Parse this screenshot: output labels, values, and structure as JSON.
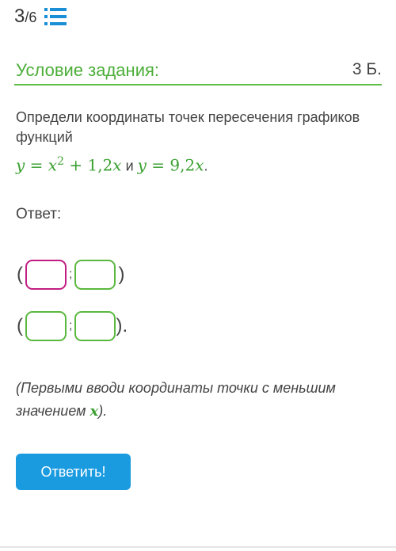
{
  "header": {
    "progress_current": "3",
    "progress_total": "/6",
    "list_icon": "list-icon"
  },
  "task": {
    "section_title": "Условие задания:",
    "points": "3 Б.",
    "text": "Определи координаты точек пересечения графиков функций",
    "formula": {
      "y1": "y",
      "eq1": " = ",
      "x1": "x",
      "pow": "2",
      "rest1": " + 1,2",
      "x2": "x",
      "conj": " и ",
      "y2": "y",
      "eq2": " = 9,2",
      "x3": "x",
      "end": "."
    }
  },
  "answer": {
    "label": "Ответ:",
    "rows": [
      {
        "open": "(",
        "sep": ";",
        "close": ")",
        "x_value": "",
        "y_value": ""
      },
      {
        "open": "(",
        "sep": ";",
        "close": ").",
        "x_value": "",
        "y_value": ""
      }
    ]
  },
  "note": {
    "text": "(Первыми вводи координаты точки с меньшим значением ",
    "var": "x",
    "end": ")."
  },
  "submit_button": {
    "label": "Ответить!"
  },
  "colors": {
    "accent_green": "#4cae39",
    "button_blue": "#1a9be0",
    "active_input": "#c21d83"
  }
}
